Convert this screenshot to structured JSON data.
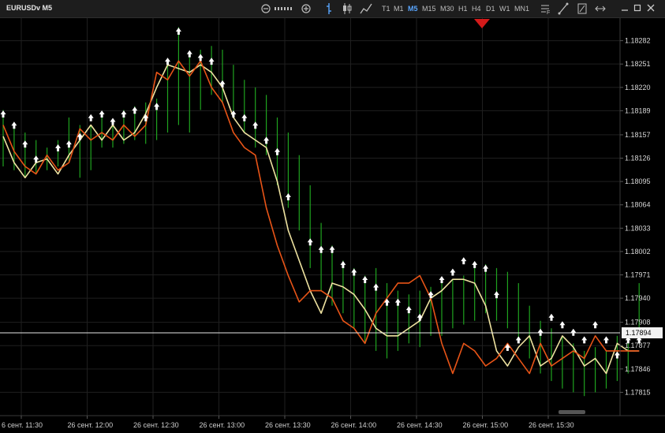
{
  "toolbar": {
    "symbol": "EURUSDv M5",
    "timeframes": [
      "T1",
      "M1",
      "M5",
      "M15",
      "M30",
      "H1",
      "H4",
      "D1",
      "W1",
      "MN1"
    ],
    "active_timeframe": "M5"
  },
  "colors": {
    "background": "#000000",
    "grid": "#1f1f1f",
    "candle": "#1fa31f",
    "fast_ma": "#e85417",
    "slow_ma": "#eee2a0",
    "signal": "#ffffff",
    "current_price_line": "#e6e6e6",
    "sell_marker": "#d31a1a"
  },
  "chart_data": {
    "type": "line",
    "title": "",
    "ylim": [
      1.17784,
      1.18313
    ],
    "y_ticks": [
      "1.18282",
      "1.18251",
      "1.18220",
      "1.18189",
      "1.18157",
      "1.18126",
      "1.18095",
      "1.18064",
      "1.18033",
      "1.18002",
      "1.17971",
      "1.17940",
      "1.17908",
      "1.17877",
      "1.17846",
      "1.17815"
    ],
    "current_price": "1.17894",
    "x_tick_labels": [
      "6 сент. 11:30",
      "26 сент. 12:00",
      "26 сент. 12:30",
      "26 сент. 13:00",
      "26 сент. 13:30",
      "26 сент. 14:00",
      "26 сент. 14:30",
      "26 сент. 15:00",
      "26 сент. 15:30"
    ],
    "bars": [
      {
        "h": 1.1819,
        "l": 1.18115
      },
      {
        "h": 1.1817,
        "l": 1.1811
      },
      {
        "h": 1.1816,
        "l": 1.181
      },
      {
        "h": 1.1815,
        "l": 1.18105
      },
      {
        "h": 1.1814,
        "l": 1.1811
      },
      {
        "h": 1.1815,
        "l": 1.18115
      },
      {
        "h": 1.1818,
        "l": 1.1812
      },
      {
        "h": 1.1817,
        "l": 1.181
      },
      {
        "h": 1.1817,
        "l": 1.1811
      },
      {
        "h": 1.1818,
        "l": 1.1814
      },
      {
        "h": 1.18175,
        "l": 1.1814
      },
      {
        "h": 1.1819,
        "l": 1.18145
      },
      {
        "h": 1.18195,
        "l": 1.1815
      },
      {
        "h": 1.182,
        "l": 1.18145
      },
      {
        "h": 1.18205,
        "l": 1.1815
      },
      {
        "h": 1.1825,
        "l": 1.1816
      },
      {
        "h": 1.183,
        "l": 1.1817
      },
      {
        "h": 1.1826,
        "l": 1.1816
      },
      {
        "h": 1.1827,
        "l": 1.1819
      },
      {
        "h": 1.18275,
        "l": 1.1821
      },
      {
        "h": 1.1827,
        "l": 1.182
      },
      {
        "h": 1.1825,
        "l": 1.1818
      },
      {
        "h": 1.1823,
        "l": 1.1816
      },
      {
        "h": 1.1822,
        "l": 1.1814
      },
      {
        "h": 1.1821,
        "l": 1.1813
      },
      {
        "h": 1.1818,
        "l": 1.1809
      },
      {
        "h": 1.1816,
        "l": 1.1806
      },
      {
        "h": 1.1813,
        "l": 1.1803
      },
      {
        "h": 1.1809,
        "l": 1.1798
      },
      {
        "h": 1.1804,
        "l": 1.1795
      },
      {
        "h": 1.1801,
        "l": 1.1793
      },
      {
        "h": 1.1799,
        "l": 1.1792
      },
      {
        "h": 1.1798,
        "l": 1.179
      },
      {
        "h": 1.1797,
        "l": 1.1788
      },
      {
        "h": 1.1798,
        "l": 1.1787
      },
      {
        "h": 1.1796,
        "l": 1.1786
      },
      {
        "h": 1.1795,
        "l": 1.1787
      },
      {
        "h": 1.17945,
        "l": 1.1788
      },
      {
        "h": 1.1795,
        "l": 1.17875
      },
      {
        "h": 1.17955,
        "l": 1.1789
      },
      {
        "h": 1.1796,
        "l": 1.1789
      },
      {
        "h": 1.17965,
        "l": 1.179
      },
      {
        "h": 1.1797,
        "l": 1.17905
      },
      {
        "h": 1.1798,
        "l": 1.1791
      },
      {
        "h": 1.17985,
        "l": 1.1792
      },
      {
        "h": 1.1798,
        "l": 1.1791
      },
      {
        "h": 1.17975,
        "l": 1.179
      },
      {
        "h": 1.1796,
        "l": 1.1788
      },
      {
        "h": 1.1793,
        "l": 1.1786
      },
      {
        "h": 1.1791,
        "l": 1.1784
      },
      {
        "h": 1.179,
        "l": 1.1783
      },
      {
        "h": 1.1789,
        "l": 1.1782
      },
      {
        "h": 1.1788,
        "l": 1.17815
      },
      {
        "h": 1.1787,
        "l": 1.1781
      },
      {
        "h": 1.17875,
        "l": 1.17815
      },
      {
        "h": 1.1787,
        "l": 1.1782
      },
      {
        "h": 1.1789,
        "l": 1.1783
      },
      {
        "h": 1.179,
        "l": 1.1784
      },
      {
        "h": 1.1796,
        "l": 1.1788
      }
    ],
    "series": [
      {
        "values": [
          1.18155,
          1.1812,
          1.181,
          1.1812,
          1.18125,
          1.18105,
          1.1813,
          1.1815,
          1.1817,
          1.1815,
          1.1817,
          1.1815,
          1.1816,
          1.18185,
          1.1822,
          1.1825,
          1.18245,
          1.1824,
          1.1825,
          1.1824,
          1.1822,
          1.1818,
          1.1816,
          1.1815,
          1.1814,
          1.18095,
          1.1803,
          1.1799,
          1.1795,
          1.1792,
          1.1796,
          1.17955,
          1.17945,
          1.17925,
          1.179,
          1.1789,
          1.1789,
          1.179,
          1.1791,
          1.1794,
          1.1795,
          1.17965,
          1.17965,
          1.1796,
          1.1793,
          1.1787,
          1.1785,
          1.17875,
          1.1789,
          1.1785,
          1.1786,
          1.1789,
          1.17875,
          1.1785,
          1.1786,
          1.1784,
          1.1788,
          1.1787,
          1.1787
        ]
      },
      {
        "values": [
          1.1817,
          1.18135,
          1.18115,
          1.18105,
          1.1813,
          1.1811,
          1.1812,
          1.18165,
          1.1815,
          1.1816,
          1.1815,
          1.1817,
          1.18155,
          1.1817,
          1.1824,
          1.1823,
          1.18255,
          1.18235,
          1.18255,
          1.1822,
          1.182,
          1.1816,
          1.1814,
          1.1813,
          1.1806,
          1.1801,
          1.1797,
          1.17935,
          1.1795,
          1.1795,
          1.1794,
          1.1791,
          1.179,
          1.1788,
          1.1792,
          1.1794,
          1.1796,
          1.1796,
          1.1797,
          1.1794,
          1.1788,
          1.1784,
          1.1788,
          1.1787,
          1.1785,
          1.1786,
          1.1788,
          1.1786,
          1.1784,
          1.1788,
          1.1785,
          1.1786,
          1.1787,
          1.1786,
          1.1789,
          1.1787,
          1.1787,
          1.1787,
          1.1787
        ]
      }
    ],
    "signals": [
      {
        "b": 0,
        "p": 1.1818
      },
      {
        "b": 1,
        "p": 1.18165
      },
      {
        "b": 2,
        "p": 1.1814
      },
      {
        "b": 3,
        "p": 1.1812
      },
      {
        "b": 5,
        "p": 1.18135
      },
      {
        "b": 6,
        "p": 1.1814
      },
      {
        "b": 7,
        "p": 1.1815
      },
      {
        "b": 8,
        "p": 1.18175
      },
      {
        "b": 9,
        "p": 1.1818
      },
      {
        "b": 10,
        "p": 1.1817
      },
      {
        "b": 11,
        "p": 1.1818
      },
      {
        "b": 12,
        "p": 1.18185
      },
      {
        "b": 13,
        "p": 1.18175
      },
      {
        "b": 14,
        "p": 1.1819
      },
      {
        "b": 15,
        "p": 1.1825
      },
      {
        "b": 16,
        "p": 1.1829
      },
      {
        "b": 17,
        "p": 1.1826
      },
      {
        "b": 18,
        "p": 1.18255
      },
      {
        "b": 19,
        "p": 1.1825
      },
      {
        "b": 20,
        "p": 1.1822
      },
      {
        "b": 21,
        "p": 1.1818
      },
      {
        "b": 22,
        "p": 1.18175
      },
      {
        "b": 23,
        "p": 1.18165
      },
      {
        "b": 24,
        "p": 1.18145
      },
      {
        "b": 25,
        "p": 1.1813
      },
      {
        "b": 26,
        "p": 1.1807
      },
      {
        "b": 28,
        "p": 1.1801
      },
      {
        "b": 29,
        "p": 1.18
      },
      {
        "b": 30,
        "p": 1.18
      },
      {
        "b": 31,
        "p": 1.1798
      },
      {
        "b": 32,
        "p": 1.1797
      },
      {
        "b": 33,
        "p": 1.1796
      },
      {
        "b": 34,
        "p": 1.1795
      },
      {
        "b": 35,
        "p": 1.1793
      },
      {
        "b": 36,
        "p": 1.1793
      },
      {
        "b": 37,
        "p": 1.1792
      },
      {
        "b": 38,
        "p": 1.1791
      },
      {
        "b": 39,
        "p": 1.1794
      },
      {
        "b": 40,
        "p": 1.1796
      },
      {
        "b": 41,
        "p": 1.1797
      },
      {
        "b": 42,
        "p": 1.17985
      },
      {
        "b": 43,
        "p": 1.1798
      },
      {
        "b": 44,
        "p": 1.17975
      },
      {
        "b": 45,
        "p": 1.1794
      },
      {
        "b": 46,
        "p": 1.1787
      },
      {
        "b": 47,
        "p": 1.1788
      },
      {
        "b": 49,
        "p": 1.1789
      },
      {
        "b": 50,
        "p": 1.1791
      },
      {
        "b": 51,
        "p": 1.179
      },
      {
        "b": 52,
        "p": 1.1789
      },
      {
        "b": 53,
        "p": 1.1788
      },
      {
        "b": 54,
        "p": 1.179
      },
      {
        "b": 55,
        "p": 1.1788
      },
      {
        "b": 56,
        "p": 1.1786
      },
      {
        "b": 57,
        "p": 1.1788
      },
      {
        "b": 58,
        "p": 1.1788
      }
    ],
    "grid": true
  }
}
